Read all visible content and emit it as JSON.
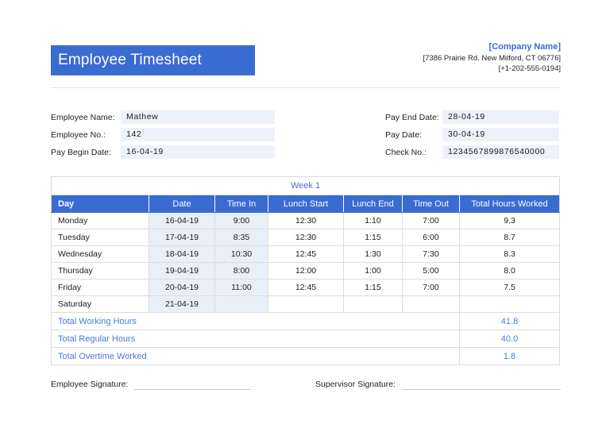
{
  "colors": {
    "accent": "#3a6bd1",
    "field-bg": "#edf2fa",
    "tint-bg": "#e9eff9",
    "week-text": "#4472c4",
    "total-text": "#4a7ad6"
  },
  "header": {
    "title": "Employee Timesheet",
    "company_name": "[Company Name]",
    "company_address": "[7386 Prairie Rd. New Milford, CT 06776]",
    "company_phone": "[+1-202-555-0194]"
  },
  "employee_info": {
    "left": [
      {
        "label": "Employee Name:",
        "value": "Mathew"
      },
      {
        "label": "Employee No.:",
        "value": "142"
      },
      {
        "label": "Pay Begin Date:",
        "value": "16-04-19"
      }
    ],
    "right": [
      {
        "label": "Pay End Date:",
        "value": "28-04-19"
      },
      {
        "label": "Pay Date:",
        "value": "30-04-19"
      },
      {
        "label": "Check No.:",
        "value": "1234567899876540000"
      }
    ]
  },
  "timesheet": {
    "week_title": "Week 1",
    "columns": [
      "Day",
      "Date",
      "Time In",
      "Lunch Start",
      "Lunch End",
      "Time Out",
      "Total Hours Worked"
    ],
    "rows": [
      {
        "day": "Monday",
        "date": "16-04-19",
        "time_in": "9:00",
        "lunch_start": "12:30",
        "lunch_end": "1:10",
        "time_out": "7:00",
        "total": "9.3"
      },
      {
        "day": "Tuesday",
        "date": "17-04-19",
        "time_in": "8:35",
        "lunch_start": "12:30",
        "lunch_end": "1:15",
        "time_out": "6:00",
        "total": "8.7"
      },
      {
        "day": "Wednesday",
        "date": "18-04-19",
        "time_in": "10:30",
        "lunch_start": "12:45",
        "lunch_end": "1:30",
        "time_out": "7:30",
        "total": "8.3"
      },
      {
        "day": "Thursday",
        "date": "19-04-19",
        "time_in": "8:00",
        "lunch_start": "12:00",
        "lunch_end": "1:00",
        "time_out": "5:00",
        "total": "8.0"
      },
      {
        "day": "Friday",
        "date": "20-04-19",
        "time_in": "11:00",
        "lunch_start": "12:45",
        "lunch_end": "1:15",
        "time_out": "7:00",
        "total": "7.5"
      },
      {
        "day": "Saturday",
        "date": "21-04-19",
        "time_in": "",
        "lunch_start": "",
        "lunch_end": "",
        "time_out": "",
        "total": ""
      }
    ],
    "totals": [
      {
        "label": "Total Working Hours",
        "value": "41.8"
      },
      {
        "label": "Total Regular Hours",
        "value": "40.0"
      },
      {
        "label": "Total Overtime Worked",
        "value": "1.8"
      }
    ]
  },
  "signatures": {
    "employee_label": "Employee Signature:",
    "supervisor_label": "Supervisor Signature:"
  }
}
